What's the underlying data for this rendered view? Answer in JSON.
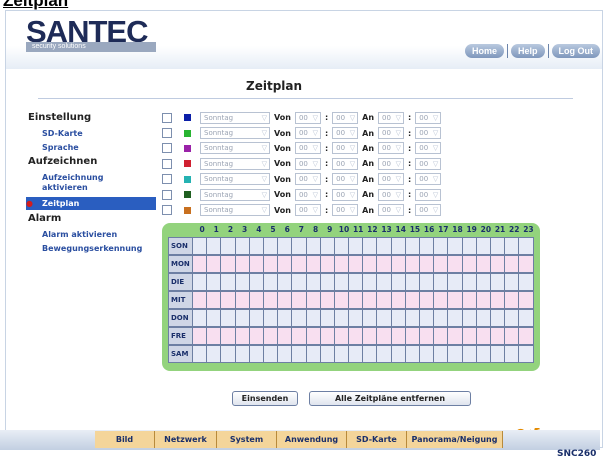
{
  "doc_title": "Zeitplan",
  "logo": {
    "text_main": "SANTEC",
    "tagline": "security solutions"
  },
  "topnav": {
    "home": "Home",
    "help": "Help",
    "logout": "Log Out"
  },
  "page_title": "Zeitplan",
  "sidebar": {
    "einstellung": "Einstellung",
    "sd_karte": "SD-Karte",
    "sprache": "Sprache",
    "aufzeichnen": "Aufzeichnen",
    "aufzeichnung_aktivieren": "Aufzeichnung aktivieren",
    "zeitplan": "Zeitplan",
    "alarm": "Alarm",
    "alarm_aktivieren": "Alarm aktivieren",
    "bewegungserkennung": "Bewegungserkennung"
  },
  "schedule_rows": [
    {
      "color": "#0b1fa8",
      "day": "Sonntag",
      "von_label": "Von",
      "von_h": "00",
      "von_m": "00",
      "an_label": "An",
      "an_h": "00",
      "an_m": "00"
    },
    {
      "color": "#28b431",
      "day": "Sonntag",
      "von_label": "Von",
      "von_h": "00",
      "von_m": "00",
      "an_label": "An",
      "an_h": "00",
      "an_m": "00"
    },
    {
      "color": "#9a22a8",
      "day": "Sonntag",
      "von_label": "Von",
      "von_h": "00",
      "von_m": "00",
      "an_label": "An",
      "an_h": "00",
      "an_m": "00"
    },
    {
      "color": "#d02030",
      "day": "Sonntag",
      "von_label": "Von",
      "von_h": "00",
      "von_m": "00",
      "an_label": "An",
      "an_h": "00",
      "an_m": "00"
    },
    {
      "color": "#25b2b2",
      "day": "Sonntag",
      "von_label": "Von",
      "von_h": "00",
      "von_m": "00",
      "an_label": "An",
      "an_h": "00",
      "an_m": "00"
    },
    {
      "color": "#1f5f20",
      "day": "Sonntag",
      "von_label": "Von",
      "von_h": "00",
      "von_m": "00",
      "an_label": "An",
      "an_h": "00",
      "an_m": "00"
    },
    {
      "color": "#c8701f",
      "day": "Sonntag",
      "von_label": "Von",
      "von_h": "00",
      "von_m": "00",
      "an_label": "An",
      "an_h": "00",
      "an_m": "00"
    }
  ],
  "grid": {
    "hours": [
      "0",
      "1",
      "2",
      "3",
      "4",
      "5",
      "6",
      "7",
      "8",
      "9",
      "10",
      "11",
      "12",
      "13",
      "14",
      "15",
      "16",
      "17",
      "18",
      "19",
      "20",
      "21",
      "22",
      "23"
    ],
    "days": [
      "SON",
      "MON",
      "DIE",
      "MIT",
      "DON",
      "FRE",
      "SAM"
    ]
  },
  "buttons": {
    "submit": "Einsenden",
    "clear": "Alle Zeitpläne entfernen"
  },
  "bottom_tabs": [
    "Bild",
    "Netzwerk",
    "System",
    "Anwendung",
    "SD-Karte",
    "Panorama/Neigung"
  ],
  "model": "SNC260"
}
